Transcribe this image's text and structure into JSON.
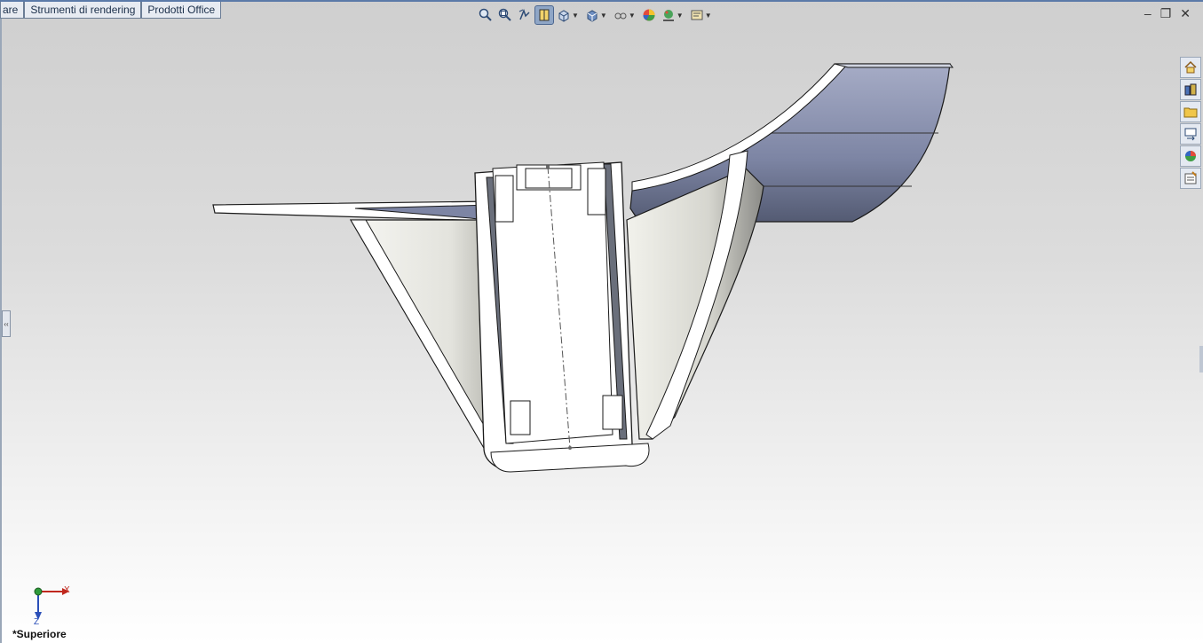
{
  "tabs": [
    "are",
    "Strumenti di rendering",
    "Prodotti Office"
  ],
  "hud_icons": [
    "zoom-to-fit-icon",
    "zoom-to-area-icon",
    "previous-view-icon",
    "section-view-icon",
    "view-orientation-icon",
    "display-style-icon",
    "hide-show-items-icon",
    "edit-appearance-icon",
    "apply-scene-icon",
    "view-settings-icon"
  ],
  "task_pane_icons": [
    "home-icon",
    "design-library-icon",
    "file-explorer-icon",
    "view-palette-icon",
    "appearances-icon",
    "custom-properties-icon"
  ],
  "triad": {
    "x_label": "X",
    "z_label": "Z"
  },
  "view_name": "*Superiore",
  "colors": {
    "tab_bg": "#e7ebf2",
    "tab_border": "#6b7d95",
    "model_edge": "#1a1a1a",
    "model_face_blue": "#8e96b4",
    "model_face_white": "#ffffff",
    "bg_top": "#cfcfcf",
    "bg_bottom": "#ffffff"
  }
}
